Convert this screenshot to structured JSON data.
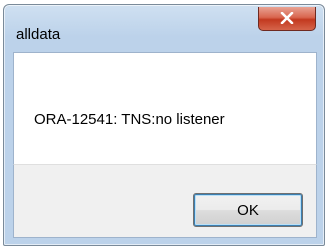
{
  "window": {
    "title": "alldata",
    "close_icon": "close-icon"
  },
  "dialog": {
    "message": "ORA-12541: TNS:no listener",
    "ok_label": "OK"
  },
  "colors": {
    "title_bar": "#bcd2ea",
    "close_button": "#c2391f",
    "footer": "#f0f0f0",
    "content": "#ffffff"
  }
}
